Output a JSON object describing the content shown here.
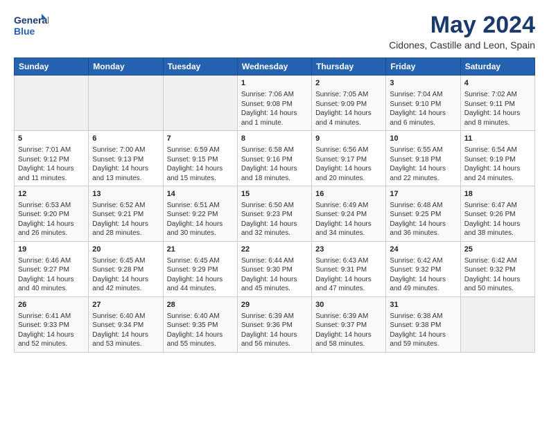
{
  "logo": {
    "line1": "General",
    "line2": "Blue"
  },
  "title": "May 2024",
  "subtitle": "Cidones, Castille and Leon, Spain",
  "days_header": [
    "Sunday",
    "Monday",
    "Tuesday",
    "Wednesday",
    "Thursday",
    "Friday",
    "Saturday"
  ],
  "weeks": [
    [
      {
        "day": "",
        "content": ""
      },
      {
        "day": "",
        "content": ""
      },
      {
        "day": "",
        "content": ""
      },
      {
        "day": "1",
        "content": "Sunrise: 7:06 AM\nSunset: 9:08 PM\nDaylight: 14 hours and 1 minute."
      },
      {
        "day": "2",
        "content": "Sunrise: 7:05 AM\nSunset: 9:09 PM\nDaylight: 14 hours and 4 minutes."
      },
      {
        "day": "3",
        "content": "Sunrise: 7:04 AM\nSunset: 9:10 PM\nDaylight: 14 hours and 6 minutes."
      },
      {
        "day": "4",
        "content": "Sunrise: 7:02 AM\nSunset: 9:11 PM\nDaylight: 14 hours and 8 minutes."
      }
    ],
    [
      {
        "day": "5",
        "content": "Sunrise: 7:01 AM\nSunset: 9:12 PM\nDaylight: 14 hours and 11 minutes."
      },
      {
        "day": "6",
        "content": "Sunrise: 7:00 AM\nSunset: 9:13 PM\nDaylight: 14 hours and 13 minutes."
      },
      {
        "day": "7",
        "content": "Sunrise: 6:59 AM\nSunset: 9:15 PM\nDaylight: 14 hours and 15 minutes."
      },
      {
        "day": "8",
        "content": "Sunrise: 6:58 AM\nSunset: 9:16 PM\nDaylight: 14 hours and 18 minutes."
      },
      {
        "day": "9",
        "content": "Sunrise: 6:56 AM\nSunset: 9:17 PM\nDaylight: 14 hours and 20 minutes."
      },
      {
        "day": "10",
        "content": "Sunrise: 6:55 AM\nSunset: 9:18 PM\nDaylight: 14 hours and 22 minutes."
      },
      {
        "day": "11",
        "content": "Sunrise: 6:54 AM\nSunset: 9:19 PM\nDaylight: 14 hours and 24 minutes."
      }
    ],
    [
      {
        "day": "12",
        "content": "Sunrise: 6:53 AM\nSunset: 9:20 PM\nDaylight: 14 hours and 26 minutes."
      },
      {
        "day": "13",
        "content": "Sunrise: 6:52 AM\nSunset: 9:21 PM\nDaylight: 14 hours and 28 minutes."
      },
      {
        "day": "14",
        "content": "Sunrise: 6:51 AM\nSunset: 9:22 PM\nDaylight: 14 hours and 30 minutes."
      },
      {
        "day": "15",
        "content": "Sunrise: 6:50 AM\nSunset: 9:23 PM\nDaylight: 14 hours and 32 minutes."
      },
      {
        "day": "16",
        "content": "Sunrise: 6:49 AM\nSunset: 9:24 PM\nDaylight: 14 hours and 34 minutes."
      },
      {
        "day": "17",
        "content": "Sunrise: 6:48 AM\nSunset: 9:25 PM\nDaylight: 14 hours and 36 minutes."
      },
      {
        "day": "18",
        "content": "Sunrise: 6:47 AM\nSunset: 9:26 PM\nDaylight: 14 hours and 38 minutes."
      }
    ],
    [
      {
        "day": "19",
        "content": "Sunrise: 6:46 AM\nSunset: 9:27 PM\nDaylight: 14 hours and 40 minutes."
      },
      {
        "day": "20",
        "content": "Sunrise: 6:45 AM\nSunset: 9:28 PM\nDaylight: 14 hours and 42 minutes."
      },
      {
        "day": "21",
        "content": "Sunrise: 6:45 AM\nSunset: 9:29 PM\nDaylight: 14 hours and 44 minutes."
      },
      {
        "day": "22",
        "content": "Sunrise: 6:44 AM\nSunset: 9:30 PM\nDaylight: 14 hours and 45 minutes."
      },
      {
        "day": "23",
        "content": "Sunrise: 6:43 AM\nSunset: 9:31 PM\nDaylight: 14 hours and 47 minutes."
      },
      {
        "day": "24",
        "content": "Sunrise: 6:42 AM\nSunset: 9:32 PM\nDaylight: 14 hours and 49 minutes."
      },
      {
        "day": "25",
        "content": "Sunrise: 6:42 AM\nSunset: 9:32 PM\nDaylight: 14 hours and 50 minutes."
      }
    ],
    [
      {
        "day": "26",
        "content": "Sunrise: 6:41 AM\nSunset: 9:33 PM\nDaylight: 14 hours and 52 minutes."
      },
      {
        "day": "27",
        "content": "Sunrise: 6:40 AM\nSunset: 9:34 PM\nDaylight: 14 hours and 53 minutes."
      },
      {
        "day": "28",
        "content": "Sunrise: 6:40 AM\nSunset: 9:35 PM\nDaylight: 14 hours and 55 minutes."
      },
      {
        "day": "29",
        "content": "Sunrise: 6:39 AM\nSunset: 9:36 PM\nDaylight: 14 hours and 56 minutes."
      },
      {
        "day": "30",
        "content": "Sunrise: 6:39 AM\nSunset: 9:37 PM\nDaylight: 14 hours and 58 minutes."
      },
      {
        "day": "31",
        "content": "Sunrise: 6:38 AM\nSunset: 9:38 PM\nDaylight: 14 hours and 59 minutes."
      },
      {
        "day": "",
        "content": ""
      }
    ]
  ]
}
